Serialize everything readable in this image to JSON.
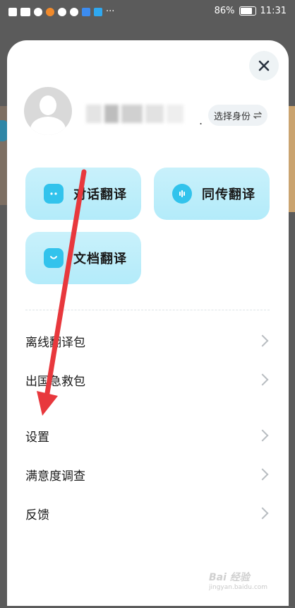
{
  "status_bar": {
    "left_icons": [
      "hd-icon",
      "signal-icon",
      "wifi-icon",
      "app-icon",
      "message-icon",
      "app-icon",
      "app-icon",
      "app-icon",
      "more-icon"
    ],
    "battery_percent": "86%",
    "time": "11:31"
  },
  "panel": {
    "close_icon": "close-icon",
    "profile": {
      "avatar_icon": "default-avatar-icon",
      "identity_button_label": "选择身份",
      "identity_button_icon": "swap-icon"
    },
    "features": [
      {
        "label": "对话翻译",
        "icon": "dialog-translate-icon"
      },
      {
        "label": "同传翻译",
        "icon": "simultaneous-translate-icon"
      },
      {
        "label": "文档翻译",
        "icon": "document-translate-icon"
      }
    ],
    "menu": [
      {
        "label": "离线翻译包"
      },
      {
        "label": "出国急救包"
      },
      {
        "label": "设置"
      },
      {
        "label": "满意度调查"
      },
      {
        "label": "反馈"
      }
    ]
  },
  "watermark": {
    "brand": "Bai 经验",
    "sub": "jingyan.baidu.com"
  },
  "colors": {
    "card_bg": "#c4effa",
    "icon_accent": "#32c3ec",
    "annotation_arrow": "#e8383d"
  }
}
